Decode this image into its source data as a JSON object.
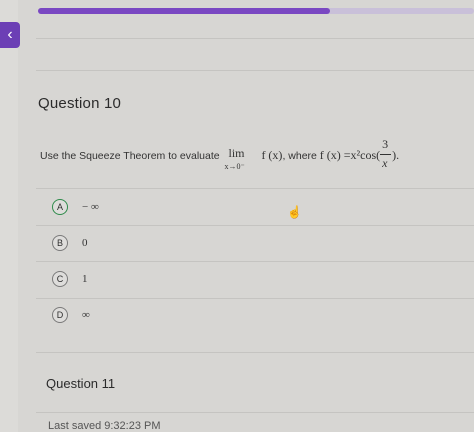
{
  "nav": {
    "back_icon": "‹"
  },
  "progress": {
    "value": 0.67
  },
  "question": {
    "title": "Question 10",
    "prompt_text": "Use the Squeeze Theorem to evaluate",
    "lim": "lim",
    "lim_sub": "x→0⁻",
    "func": "f (x)",
    "where_text": ", where ",
    "func_def": "f (x) =x²cos(",
    "frac_num": "3",
    "frac_den": "x",
    "close": ")."
  },
  "options": [
    {
      "letter": "A",
      "text": "− ∞",
      "selected": true
    },
    {
      "letter": "B",
      "text": "0",
      "selected": false
    },
    {
      "letter": "C",
      "text": "1",
      "selected": false
    },
    {
      "letter": "D",
      "text": "∞",
      "selected": false
    }
  ],
  "next_question": {
    "title": "Question 11"
  },
  "footer": {
    "saved": "Last saved 9:32:23 PM"
  },
  "colors": {
    "accent": "#7a48c2",
    "selected_ring": "#2f8b4b"
  }
}
